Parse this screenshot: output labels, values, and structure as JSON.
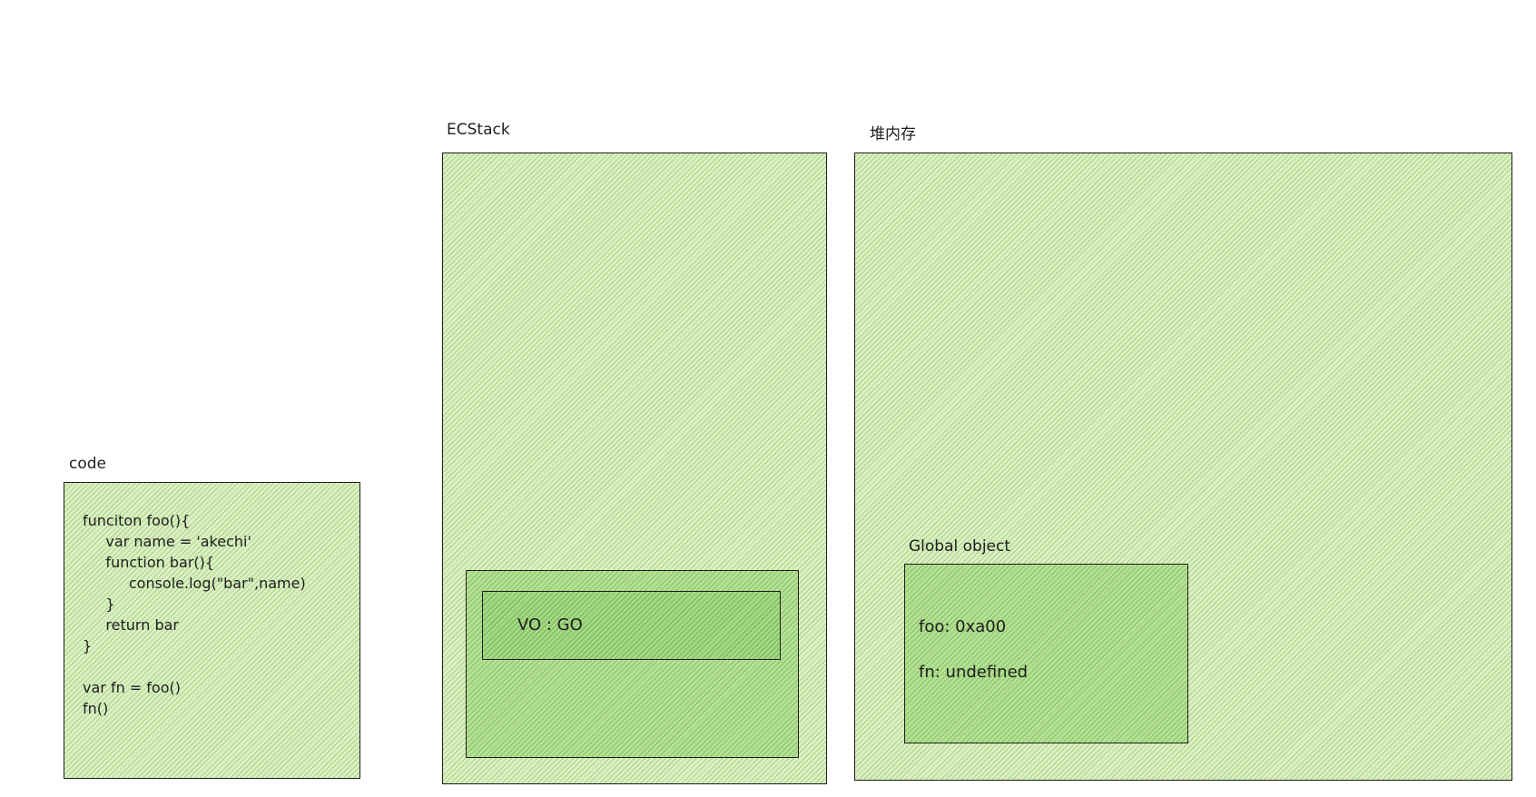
{
  "code_panel": {
    "label": "code",
    "lines": [
      "funciton foo(){",
      "     var name = 'akechi'",
      "     function bar(){",
      "          console.log(\"bar\",name)",
      "     }",
      "     return bar",
      "}",
      "",
      "var fn = foo()",
      "fn()"
    ]
  },
  "ecstack": {
    "label": "ECStack",
    "vo_text": "VO : GO"
  },
  "heap": {
    "label": "堆内存",
    "global_object": {
      "label": "Global object",
      "foo_entry": "foo: 0xa00",
      "fn_entry": "fn: undefined"
    }
  },
  "colors": {
    "stroke": "#1e1e1e",
    "fill_light": "#dcefc6",
    "fill_medium": "#b6e096",
    "fill_dark": "#a5d884"
  }
}
